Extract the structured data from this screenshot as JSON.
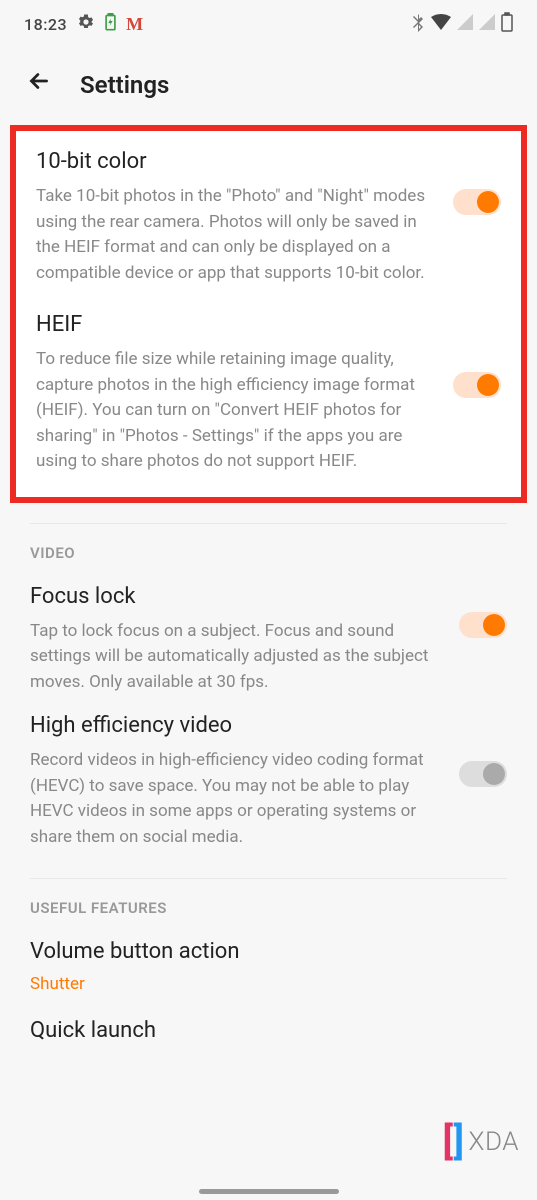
{
  "statusBar": {
    "time": "18:23"
  },
  "header": {
    "title": "Settings"
  },
  "highlighted": {
    "tenBit": {
      "title": "10-bit color",
      "desc": "Take 10-bit photos in the \"Photo\" and \"Night\" modes using the rear camera. Photos will only be saved in the HEIF format and can only be displayed on a compatible device or app that supports 10-bit color.",
      "enabled": true
    },
    "heif": {
      "title": "HEIF",
      "desc": "To reduce file size while retaining image quality, capture photos in the high efficiency image format (HEIF). You can turn on \"Convert HEIF photos for sharing\" in \"Photos - Settings\" if the apps you are using to share photos do not support HEIF.",
      "enabled": true
    }
  },
  "sections": {
    "video": {
      "header": "VIDEO",
      "focusLock": {
        "title": "Focus lock",
        "desc": "Tap to lock focus on a subject. Focus and sound settings will be automatically adjusted as the subject moves. Only available at 30 fps.",
        "enabled": true
      },
      "hev": {
        "title": "High efficiency video",
        "desc": "Record videos in high-efficiency video coding format (HEVC) to save space. You may not be able to play HEVC videos in some apps or operating systems or share them on social media.",
        "enabled": false
      }
    },
    "useful": {
      "header": "USEFUL FEATURES",
      "volumeButton": {
        "title": "Volume button action",
        "value": "Shutter"
      },
      "quickLaunch": {
        "title": "Quick launch"
      }
    }
  },
  "watermark": {
    "text": "XDA"
  }
}
